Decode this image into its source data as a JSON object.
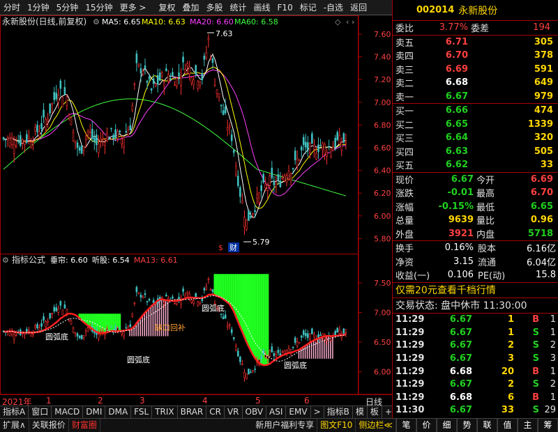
{
  "menubar": {
    "items": [
      "分时",
      "1分钟",
      "5分钟",
      "15分钟",
      "更多 >",
      "复权",
      "叠加",
      "多股",
      "统计",
      "画线",
      "F10",
      "标记",
      "-自选",
      "返回"
    ]
  },
  "main_chart": {
    "title": "永新股份(日线,前复权)",
    "ma5_label": "MA5: 6.65",
    "ma10_label": "MA10: 6.63",
    "ma20_label": "MA20: 6.60",
    "ma60_label": "MA60: 6.58",
    "high_annotation": "7.63",
    "low_annotation": "5.79",
    "marker1": "$",
    "marker2": "财",
    "y_ticks": [
      "7.60",
      "7.40",
      "7.20",
      "7.00",
      "6.80",
      "6.60",
      "6.40",
      "6.20",
      "6.00",
      "5.80"
    ],
    "colors": {
      "ma5": "#ffffff",
      "ma10": "#ffff00",
      "ma20": "#ff40ff",
      "ma60": "#40ff40",
      "up": "#ff3030",
      "down": "#40c0c0"
    }
  },
  "indicator_chart": {
    "title": "指标公式",
    "label1": "垂帘: 6.60",
    "label2": "听股: 6.54",
    "label3": "MA13: 6.61",
    "y_ticks": [
      "7.50",
      "7.00",
      "6.50",
      "6.00"
    ],
    "annotations": [
      "圆弧底",
      "圆弧底",
      "圆弧底",
      "缺口回补",
      "圆弧底"
    ]
  },
  "x_axis": {
    "labels": [
      "2021年",
      "1",
      "2",
      "3",
      "4",
      "5",
      "6"
    ],
    "right_label": "日线"
  },
  "tabs_row1": [
    "指标A",
    "窗口",
    "MACD",
    "DMI",
    "DMA",
    "FSL",
    "TRIX",
    "BRAR",
    "CR",
    "VR",
    "OBV",
    "ASI",
    "EMV",
    ">",
    "指标B",
    "模",
    "板",
    "+",
    "-"
  ],
  "tabs_row2": {
    "left": [
      "扩展∧",
      "关联报价",
      "财富圈"
    ],
    "middle": [
      "新用户福利专享",
      "图文F10",
      "侧边栏≪"
    ],
    "right": [
      "笔",
      "价",
      "细",
      "势",
      "联",
      "值",
      "主",
      "筹"
    ]
  },
  "quote": {
    "code": "002014",
    "name": "永新股份",
    "weibi_label": "委比",
    "weibi": "3.77%",
    "weicha_label": "委差",
    "weicha": "194",
    "asks": [
      {
        "label": "卖五",
        "price": "6.71",
        "vol": "305"
      },
      {
        "label": "卖四",
        "price": "6.70",
        "vol": "378"
      },
      {
        "label": "卖三",
        "price": "6.69",
        "vol": "591"
      },
      {
        "label": "卖二",
        "price": "6.68",
        "vol": "649"
      },
      {
        "label": "卖一",
        "price": "6.67",
        "vol": "979"
      }
    ],
    "bids": [
      {
        "label": "买一",
        "price": "6.66",
        "vol": "474"
      },
      {
        "label": "买二",
        "price": "6.65",
        "vol": "1339"
      },
      {
        "label": "买三",
        "price": "6.64",
        "vol": "320"
      },
      {
        "label": "买四",
        "price": "6.63",
        "vol": "505"
      },
      {
        "label": "买五",
        "price": "6.62",
        "vol": "33"
      }
    ],
    "stats": [
      {
        "l1": "现价",
        "v1": "6.67",
        "c1": "grn",
        "l2": "今开",
        "v2": "6.69",
        "c2": "red"
      },
      {
        "l1": "涨跌",
        "v1": "-0.01",
        "c1": "grn",
        "l2": "最高",
        "v2": "6.70",
        "c2": "red"
      },
      {
        "l1": "涨幅",
        "v1": "-0.15%",
        "c1": "grn",
        "l2": "最低",
        "v2": "6.65",
        "c2": "grn"
      },
      {
        "l1": "总量",
        "v1": "9639",
        "c1": "yel",
        "l2": "量比",
        "v2": "0.96",
        "c2": "yel"
      },
      {
        "l1": "外盘",
        "v1": "3921",
        "c1": "red",
        "l2": "内盘",
        "v2": "5718",
        "c2": "grn"
      }
    ],
    "fund": [
      {
        "l1": "换手",
        "v1": "0.16%",
        "l2": "股本",
        "v2": "6.16亿"
      },
      {
        "l1": "净资",
        "v1": "3.15",
        "l2": "流通",
        "v2": "6.04亿"
      },
      {
        "l1": "收益(一)",
        "v1": "0.106",
        "l2": "PE(动)",
        "v2": "15.8"
      }
    ],
    "promo": "仅需20元查看千档行情",
    "trade_status": "交易状态: 盘中休市 11:30:00",
    "trades": [
      {
        "t": "11:29",
        "p": "6.67",
        "pc": "grn",
        "v": "1",
        "bs": "B",
        "bc": "red",
        "n": "1"
      },
      {
        "t": "11:29",
        "p": "6.67",
        "pc": "grn",
        "v": "1",
        "bs": "S",
        "bc": "grn",
        "n": "1"
      },
      {
        "t": "11:29",
        "p": "6.67",
        "pc": "grn",
        "v": "2",
        "bs": "S",
        "bc": "grn",
        "n": "2"
      },
      {
        "t": "11:29",
        "p": "6.67",
        "pc": "grn",
        "v": "3",
        "bs": "S",
        "bc": "grn",
        "n": "3"
      },
      {
        "t": "11:29",
        "p": "6.68",
        "pc": "wht",
        "v": "20",
        "bs": "B",
        "bc": "red",
        "n": "1"
      },
      {
        "t": "11:29",
        "p": "6.67",
        "pc": "grn",
        "v": "2",
        "bs": "S",
        "bc": "grn",
        "n": "2"
      },
      {
        "t": "11:29",
        "p": "6.68",
        "pc": "wht",
        "v": "6",
        "bs": "B",
        "bc": "red",
        "n": "1"
      },
      {
        "t": "11:30",
        "p": "6.67",
        "pc": "grn",
        "v": "33",
        "bs": "S",
        "bc": "grn",
        "n": "29"
      }
    ]
  }
}
